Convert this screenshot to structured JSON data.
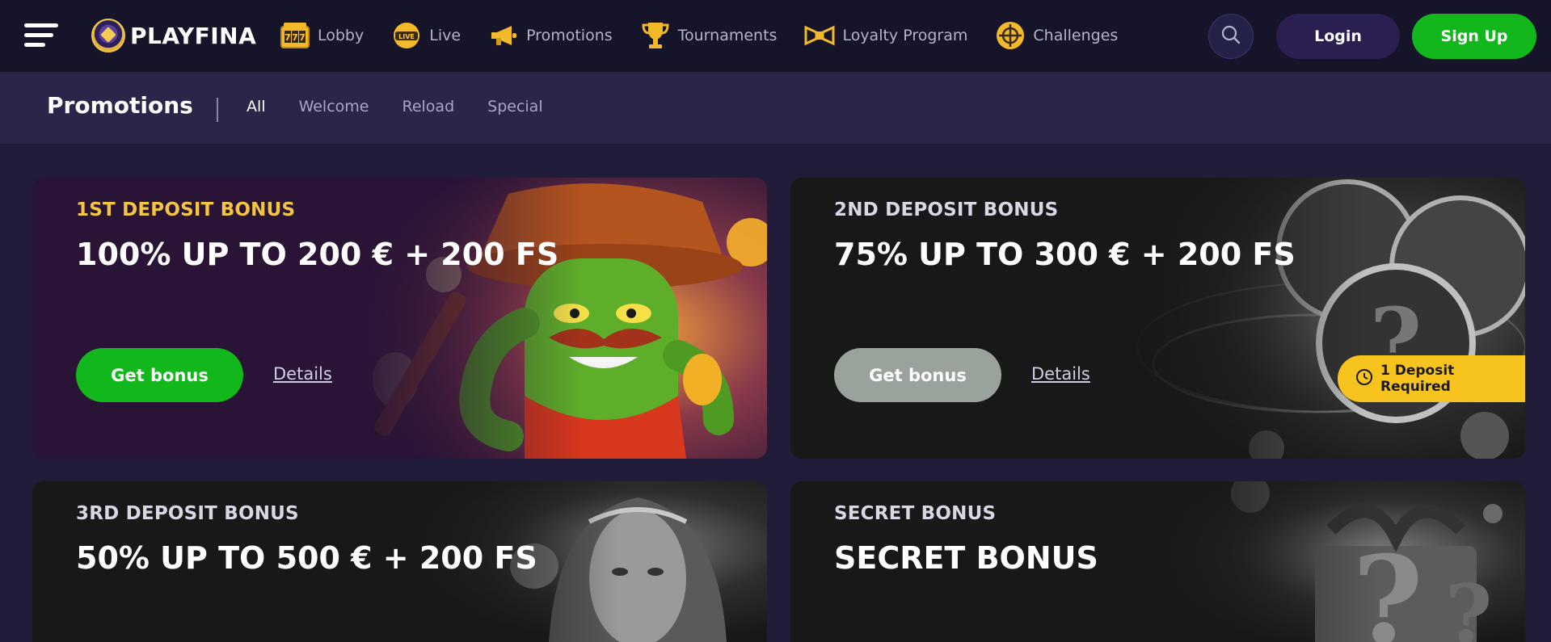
{
  "brand": {
    "name": "PLAYFINA"
  },
  "nav": {
    "items": [
      {
        "label": "Lobby",
        "icon": "slot-777-icon"
      },
      {
        "label": "Live",
        "icon": "live-badge-icon"
      },
      {
        "label": "Promotions",
        "icon": "megaphone-icon"
      },
      {
        "label": "Tournaments",
        "icon": "trophy-icon"
      },
      {
        "label": "Loyalty Program",
        "icon": "ribbon-icon"
      },
      {
        "label": "Challenges",
        "icon": "crosshair-icon"
      }
    ],
    "live_badge_text": "LIVE"
  },
  "header": {
    "login_label": "Login",
    "signup_label": "Sign Up"
  },
  "subnav": {
    "title": "Promotions",
    "tabs": [
      {
        "label": "All",
        "active": true
      },
      {
        "label": "Welcome",
        "active": false
      },
      {
        "label": "Reload",
        "active": false
      },
      {
        "label": "Special",
        "active": false
      }
    ]
  },
  "cards": [
    {
      "category": "1ST DEPOSIT BONUS",
      "headline": "100% UP TO 200 € + 200 FS",
      "button_label": "Get bonus",
      "details_label": "Details"
    },
    {
      "category": "2ND DEPOSIT BONUS",
      "headline": "75% UP TO 300 € + 200 FS",
      "button_label": "Get bonus",
      "details_label": "Details",
      "requirement_tag": "1 Deposit Required"
    },
    {
      "category": "3RD DEPOSIT BONUS",
      "headline": "50% UP TO 500 € + 200 FS"
    },
    {
      "category": "SECRET BONUS",
      "headline": "SECRET BONUS"
    }
  ],
  "colors": {
    "accent_green": "#12b81b",
    "accent_yellow": "#f7c41f",
    "category_gold": "#f4c542",
    "category_grey": "#d9d7e3",
    "disabled_button": "#9aa39b",
    "nav_bg": "#151428",
    "subnav_bg": "#29264a",
    "page_bg": "#201c3a"
  }
}
